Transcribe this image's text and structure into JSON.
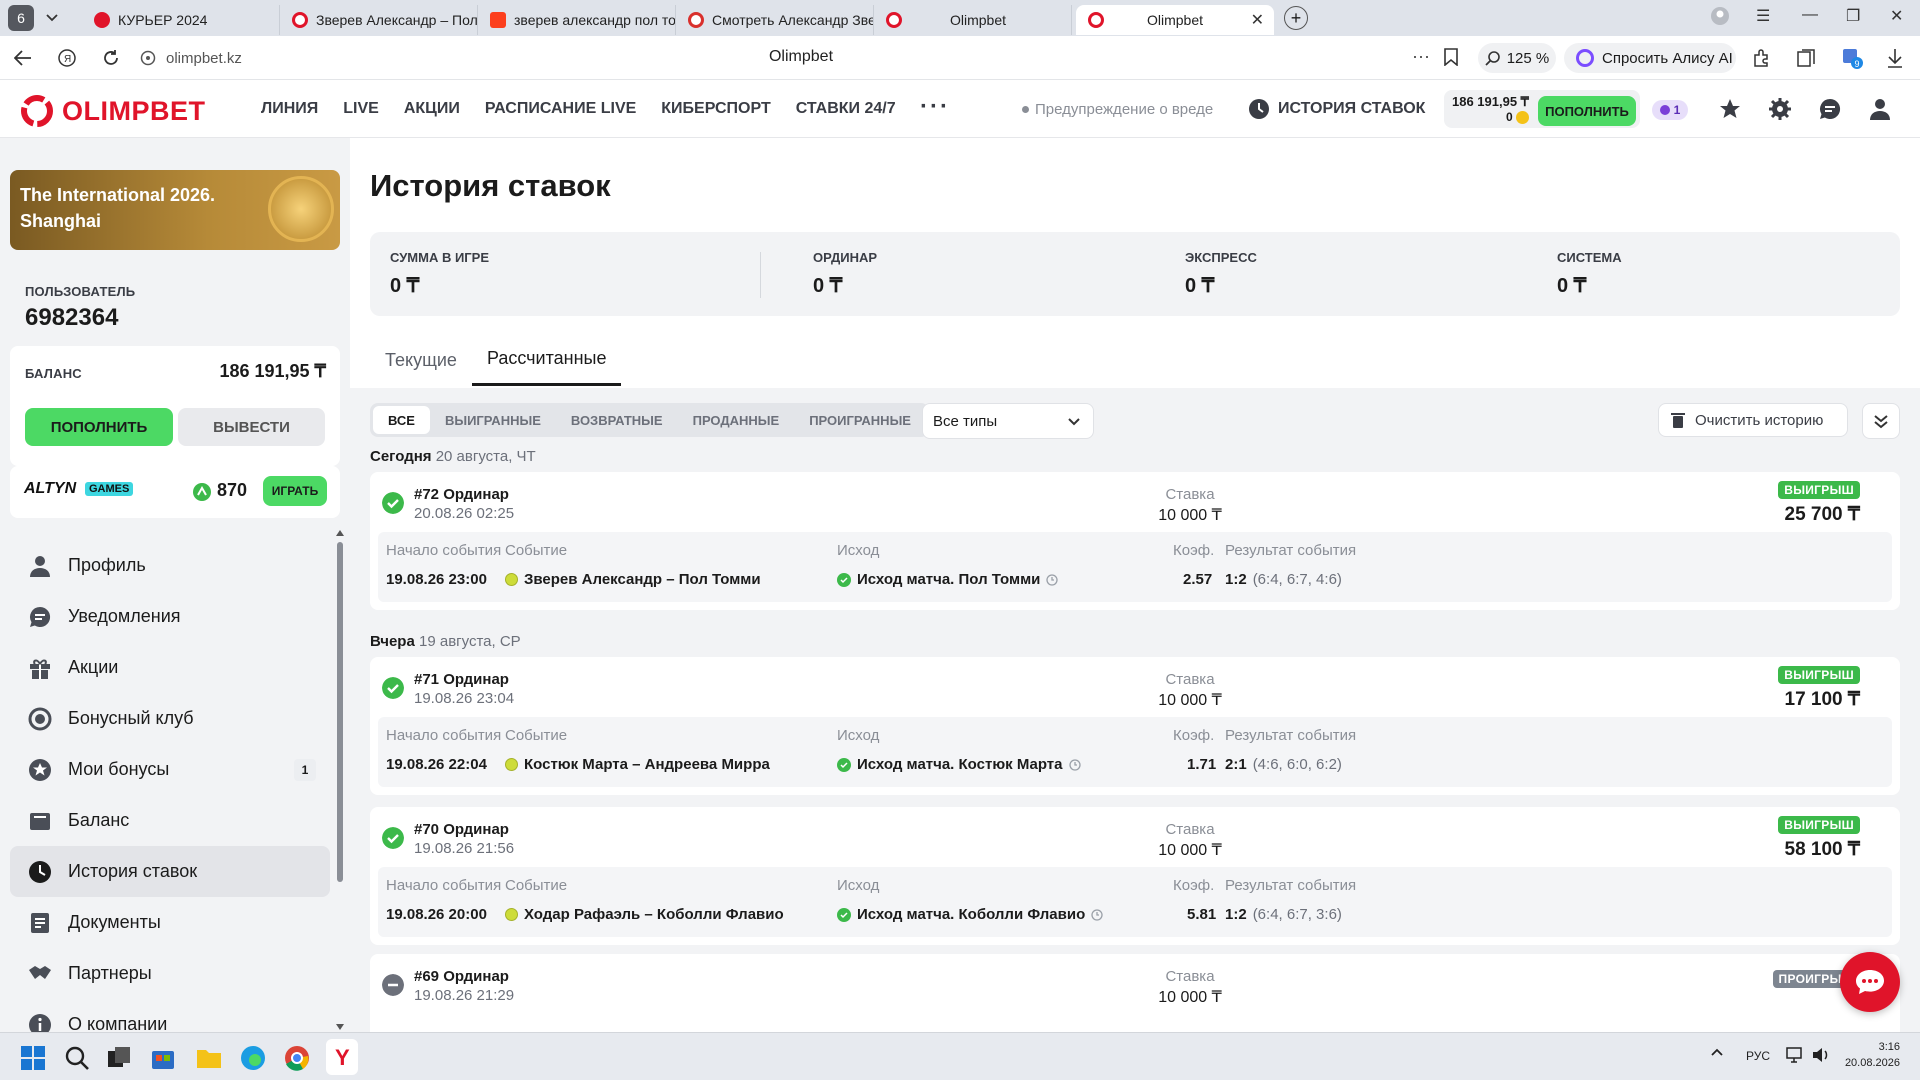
{
  "browser": {
    "tab_count": "6",
    "tabs": [
      {
        "title": "КУРЬЕР 2024",
        "color": "#e0142a"
      },
      {
        "title": "Зверев Александр – Пол",
        "color": "#e0142a"
      },
      {
        "title": "зверев александр пол то",
        "color": "#fc3f1d"
      },
      {
        "title": "Смотреть Александр Зве",
        "color": "#d9302c"
      },
      {
        "title": "Olimpbet",
        "color": "#e0142a"
      }
    ],
    "active_tab": "Olimpbet",
    "url": "olimpbet.kz",
    "page_title": "Olimpbet",
    "zoom": "125 %",
    "alice": "Спросить Алису AI",
    "ext_badge": "9"
  },
  "header": {
    "logo": "OLIMPBET",
    "nav": [
      "ЛИНИЯ",
      "LIVE",
      "АКЦИИ",
      "РАСПИСАНИЕ LIVE",
      "КИБЕРСПОРТ",
      "СТАВКИ 24/7"
    ],
    "warning": "Предупреждение о вреде",
    "history": "ИСТОРИЯ СТАВОК",
    "balance": "186 191,95 ₸",
    "bonus_balance": "0",
    "topup": "ПОПОЛНИТЬ",
    "badge_count": "1"
  },
  "sidebar": {
    "promo": "The International 2026. Shanghai",
    "user_label": "ПОЛЬЗОВАТЕЛЬ",
    "user_id": "6982364",
    "balance_label": "БАЛАНС",
    "balance": "186 191,95 ₸",
    "topup": "ПОПОЛНИТЬ",
    "withdraw": "ВЫВЕСТИ",
    "altyn": "ALTYN",
    "games": "GAMES",
    "points": "870",
    "play": "ИГРАТЬ",
    "menu": [
      {
        "label": "Профиль",
        "icon": "user-icon"
      },
      {
        "label": "Уведомления",
        "icon": "chat-icon"
      },
      {
        "label": "Акции",
        "icon": "gift-icon"
      },
      {
        "label": "Бонусный клуб",
        "icon": "club-icon"
      },
      {
        "label": "Мои бонусы",
        "icon": "star-icon",
        "count": "1"
      },
      {
        "label": "Баланс",
        "icon": "wallet-icon"
      },
      {
        "label": "История ставок",
        "icon": "clock-icon",
        "active": true
      },
      {
        "label": "Документы",
        "icon": "document-icon"
      },
      {
        "label": "Партнеры",
        "icon": "handshake-icon"
      },
      {
        "label": "О компании",
        "icon": "info-icon"
      }
    ]
  },
  "main": {
    "title": "История ставок",
    "summary": [
      {
        "label": "СУММА В ИГРЕ",
        "value": "0 ₸"
      },
      {
        "label": "ОРДИНАР",
        "value": "0 ₸"
      },
      {
        "label": "ЭКСПРЕСС",
        "value": "0 ₸"
      },
      {
        "label": "СИСТЕМА",
        "value": "0 ₸"
      }
    ],
    "tabs": [
      "Текущие",
      "Рассчитанные"
    ],
    "filters": [
      "ВСЕ",
      "ВЫИГРАННЫЕ",
      "ВОЗВРАТНЫЕ",
      "ПРОДАННЫЕ",
      "ПРОИГРАННЫЕ"
    ],
    "type_select": "Все типы",
    "clear": "Очистить историю",
    "columns": {
      "start": "Начало события",
      "event": "Событие",
      "outcome": "Исход",
      "coef": "Коэф.",
      "result": "Результат события",
      "stake": "Ставка"
    },
    "days": [
      {
        "day": "Сегодня",
        "date": "20 августа, ЧТ"
      },
      {
        "day": "Вчера",
        "date": "19 августа, СР"
      }
    ],
    "bets": [
      {
        "id": "#72 Ординар",
        "time": "20.08.26 02:25",
        "stake": "10 000 ₸",
        "status": "ВЫИГРЫШ",
        "amount": "25 700 ₸",
        "start": "19.08.26 23:00",
        "event": "Зверев Александр – Пол Томми",
        "outcome": "Исход матча. Пол Томми",
        "coef": "2.57",
        "score": "1:2",
        "sets": "(6:4, 6:7, 4:6)"
      },
      {
        "id": "#71 Ординар",
        "time": "19.08.26 23:04",
        "stake": "10 000 ₸",
        "status": "ВЫИГРЫШ",
        "amount": "17 100 ₸",
        "start": "19.08.26 22:04",
        "event": "Костюк Марта – Андреева Мирра",
        "outcome": "Исход матча. Костюк Марта",
        "coef": "1.71",
        "score": "2:1",
        "sets": "(4:6, 6:0, 6:2)"
      },
      {
        "id": "#70 Ординар",
        "time": "19.08.26 21:56",
        "stake": "10 000 ₸",
        "status": "ВЫИГРЫШ",
        "amount": "58 100 ₸",
        "start": "19.08.26 20:00",
        "event": "Ходар Рафаэль – Коболли Флавио",
        "outcome": "Исход матча. Коболли Флавио",
        "coef": "5.81",
        "score": "1:2",
        "sets": "(6:4, 6:7, 3:6)"
      },
      {
        "id": "#69 Ординар",
        "time": "19.08.26 21:29",
        "stake": "10 000 ₸",
        "status": "ПРОИГРЫШ"
      }
    ]
  },
  "taskbar": {
    "lang": "РУС",
    "time": "3:16",
    "date": "20.08.2026"
  }
}
